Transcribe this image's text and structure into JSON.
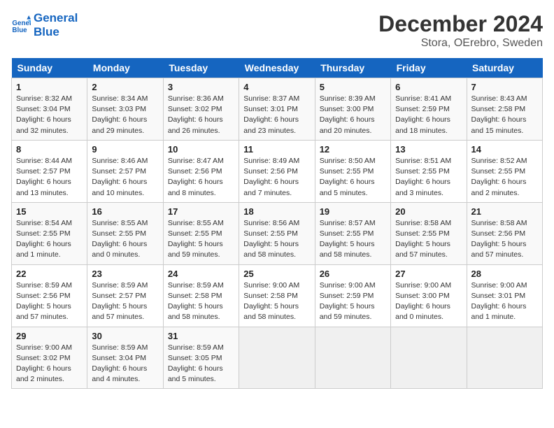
{
  "header": {
    "logo_line1": "General",
    "logo_line2": "Blue",
    "month": "December 2024",
    "location": "Stora, OErebro, Sweden"
  },
  "weekdays": [
    "Sunday",
    "Monday",
    "Tuesday",
    "Wednesday",
    "Thursday",
    "Friday",
    "Saturday"
  ],
  "weeks": [
    [
      {
        "day": "1",
        "info": "Sunrise: 8:32 AM\nSunset: 3:04 PM\nDaylight: 6 hours\nand 32 minutes."
      },
      {
        "day": "2",
        "info": "Sunrise: 8:34 AM\nSunset: 3:03 PM\nDaylight: 6 hours\nand 29 minutes."
      },
      {
        "day": "3",
        "info": "Sunrise: 8:36 AM\nSunset: 3:02 PM\nDaylight: 6 hours\nand 26 minutes."
      },
      {
        "day": "4",
        "info": "Sunrise: 8:37 AM\nSunset: 3:01 PM\nDaylight: 6 hours\nand 23 minutes."
      },
      {
        "day": "5",
        "info": "Sunrise: 8:39 AM\nSunset: 3:00 PM\nDaylight: 6 hours\nand 20 minutes."
      },
      {
        "day": "6",
        "info": "Sunrise: 8:41 AM\nSunset: 2:59 PM\nDaylight: 6 hours\nand 18 minutes."
      },
      {
        "day": "7",
        "info": "Sunrise: 8:43 AM\nSunset: 2:58 PM\nDaylight: 6 hours\nand 15 minutes."
      }
    ],
    [
      {
        "day": "8",
        "info": "Sunrise: 8:44 AM\nSunset: 2:57 PM\nDaylight: 6 hours\nand 13 minutes."
      },
      {
        "day": "9",
        "info": "Sunrise: 8:46 AM\nSunset: 2:57 PM\nDaylight: 6 hours\nand 10 minutes."
      },
      {
        "day": "10",
        "info": "Sunrise: 8:47 AM\nSunset: 2:56 PM\nDaylight: 6 hours\nand 8 minutes."
      },
      {
        "day": "11",
        "info": "Sunrise: 8:49 AM\nSunset: 2:56 PM\nDaylight: 6 hours\nand 7 minutes."
      },
      {
        "day": "12",
        "info": "Sunrise: 8:50 AM\nSunset: 2:55 PM\nDaylight: 6 hours\nand 5 minutes."
      },
      {
        "day": "13",
        "info": "Sunrise: 8:51 AM\nSunset: 2:55 PM\nDaylight: 6 hours\nand 3 minutes."
      },
      {
        "day": "14",
        "info": "Sunrise: 8:52 AM\nSunset: 2:55 PM\nDaylight: 6 hours\nand 2 minutes."
      }
    ],
    [
      {
        "day": "15",
        "info": "Sunrise: 8:54 AM\nSunset: 2:55 PM\nDaylight: 6 hours\nand 1 minute."
      },
      {
        "day": "16",
        "info": "Sunrise: 8:55 AM\nSunset: 2:55 PM\nDaylight: 6 hours\nand 0 minutes."
      },
      {
        "day": "17",
        "info": "Sunrise: 8:55 AM\nSunset: 2:55 PM\nDaylight: 5 hours\nand 59 minutes."
      },
      {
        "day": "18",
        "info": "Sunrise: 8:56 AM\nSunset: 2:55 PM\nDaylight: 5 hours\nand 58 minutes."
      },
      {
        "day": "19",
        "info": "Sunrise: 8:57 AM\nSunset: 2:55 PM\nDaylight: 5 hours\nand 58 minutes."
      },
      {
        "day": "20",
        "info": "Sunrise: 8:58 AM\nSunset: 2:55 PM\nDaylight: 5 hours\nand 57 minutes."
      },
      {
        "day": "21",
        "info": "Sunrise: 8:58 AM\nSunset: 2:56 PM\nDaylight: 5 hours\nand 57 minutes."
      }
    ],
    [
      {
        "day": "22",
        "info": "Sunrise: 8:59 AM\nSunset: 2:56 PM\nDaylight: 5 hours\nand 57 minutes."
      },
      {
        "day": "23",
        "info": "Sunrise: 8:59 AM\nSunset: 2:57 PM\nDaylight: 5 hours\nand 57 minutes."
      },
      {
        "day": "24",
        "info": "Sunrise: 8:59 AM\nSunset: 2:58 PM\nDaylight: 5 hours\nand 58 minutes."
      },
      {
        "day": "25",
        "info": "Sunrise: 9:00 AM\nSunset: 2:58 PM\nDaylight: 5 hours\nand 58 minutes."
      },
      {
        "day": "26",
        "info": "Sunrise: 9:00 AM\nSunset: 2:59 PM\nDaylight: 5 hours\nand 59 minutes."
      },
      {
        "day": "27",
        "info": "Sunrise: 9:00 AM\nSunset: 3:00 PM\nDaylight: 6 hours\nand 0 minutes."
      },
      {
        "day": "28",
        "info": "Sunrise: 9:00 AM\nSunset: 3:01 PM\nDaylight: 6 hours\nand 1 minute."
      }
    ],
    [
      {
        "day": "29",
        "info": "Sunrise: 9:00 AM\nSunset: 3:02 PM\nDaylight: 6 hours\nand 2 minutes."
      },
      {
        "day": "30",
        "info": "Sunrise: 8:59 AM\nSunset: 3:04 PM\nDaylight: 6 hours\nand 4 minutes."
      },
      {
        "day": "31",
        "info": "Sunrise: 8:59 AM\nSunset: 3:05 PM\nDaylight: 6 hours\nand 5 minutes."
      },
      {
        "day": "",
        "info": ""
      },
      {
        "day": "",
        "info": ""
      },
      {
        "day": "",
        "info": ""
      },
      {
        "day": "",
        "info": ""
      }
    ]
  ]
}
